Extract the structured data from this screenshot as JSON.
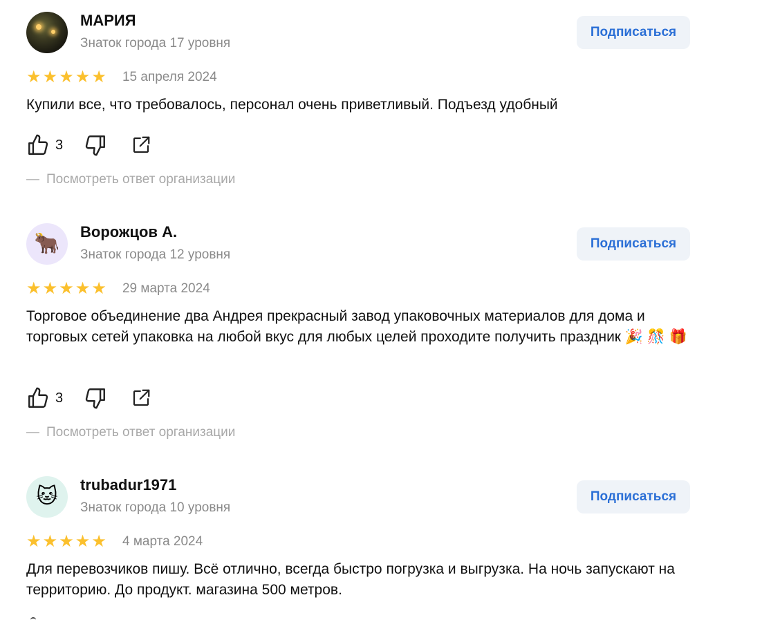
{
  "subscribe_label": "Подписаться",
  "org_reply_label": "Посмотреть ответ организации",
  "org_reply_dash": "—",
  "star_char": "★",
  "colors": {
    "star": "#fbc02d",
    "subscribe_text": "#2b6fd6",
    "subscribe_bg": "#eff3f8",
    "muted": "#8a8a8a"
  },
  "reviews": [
    {
      "author": "МАРИЯ",
      "level": "Знаток города 17 уровня",
      "avatar_icon": "photo-avatar",
      "rating": 5,
      "date": "15 апреля 2024",
      "text": "Купили все, что требовалось, персонал очень приветливый. Подъезд удобный",
      "likes": "3"
    },
    {
      "author": "Ворожцов А.",
      "level": "Знаток города 12 уровня",
      "avatar_icon": "bull-icon",
      "avatar_emoji": "🐂",
      "rating": 5,
      "date": "29 марта 2024",
      "text": "Торговое объединение два Андрея прекрасный завод упаковочных материалов для дома и торговых сетей упаковка на любой вкус для любых целей проходите получить праздник 🎉 🎊 🎁",
      "likes": "3"
    },
    {
      "author": "trubadur1971",
      "level": "Знаток города 10 уровня",
      "avatar_icon": "cat-icon",
      "avatar_emoji": "🐱",
      "rating": 5,
      "date": "4 марта 2024",
      "text": "Для перевозчиков пишу. Всё отлично, всегда быстро погрузка и выгрузка. На ночь запускают на территорию. До продукт. магазина 500 метров."
    }
  ]
}
